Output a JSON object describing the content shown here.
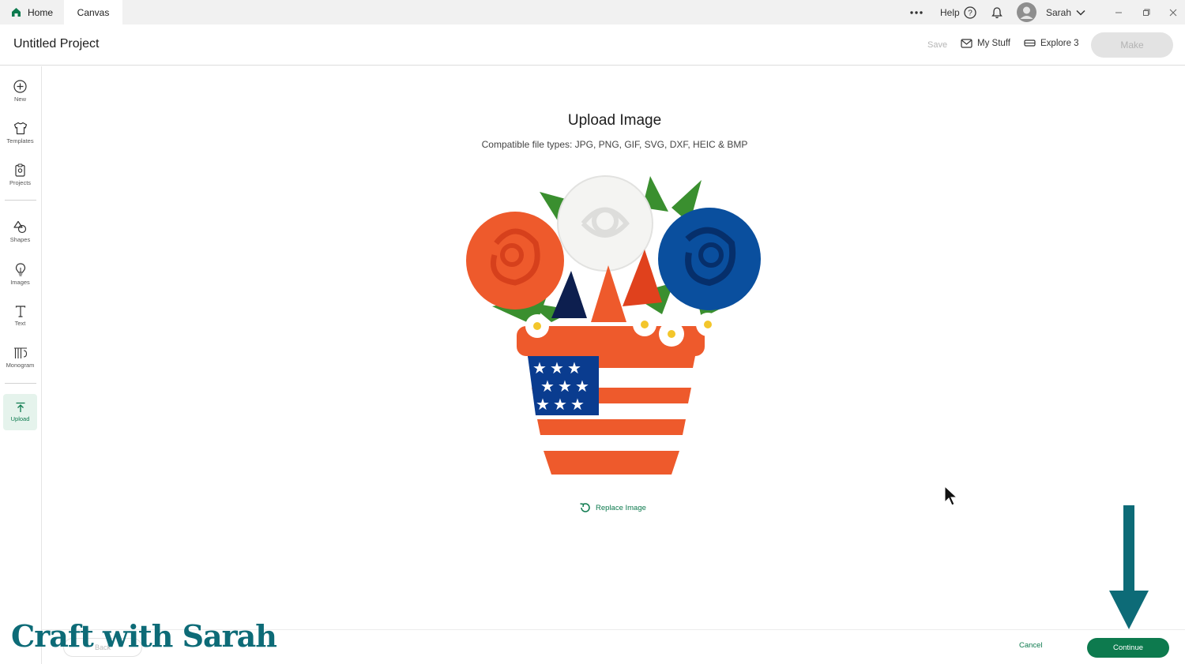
{
  "tabs": {
    "home": "Home",
    "canvas": "Canvas"
  },
  "topbar": {
    "help": "Help",
    "user": "Sarah"
  },
  "header": {
    "title": "Untitled Project",
    "save": "Save",
    "my_stuff": "My Stuff",
    "machine": "Explore 3",
    "make": "Make"
  },
  "sidebar": {
    "new": "New",
    "templates": "Templates",
    "projects": "Projects",
    "shapes": "Shapes",
    "images": "Images",
    "text": "Text",
    "monogram": "Monogram",
    "upload": "Upload"
  },
  "upload": {
    "title": "Upload Image",
    "file_types": "Compatible file types:  JPG, PNG, GIF, SVG, DXF, HEIC & BMP",
    "replace": "Replace Image"
  },
  "footer": {
    "back": "Back",
    "cancel": "Cancel",
    "continue": "Continue"
  },
  "watermark": "Craft with Sarah",
  "colors": {
    "accent": "#0d7a4e",
    "arrow": "#0d6b77"
  }
}
